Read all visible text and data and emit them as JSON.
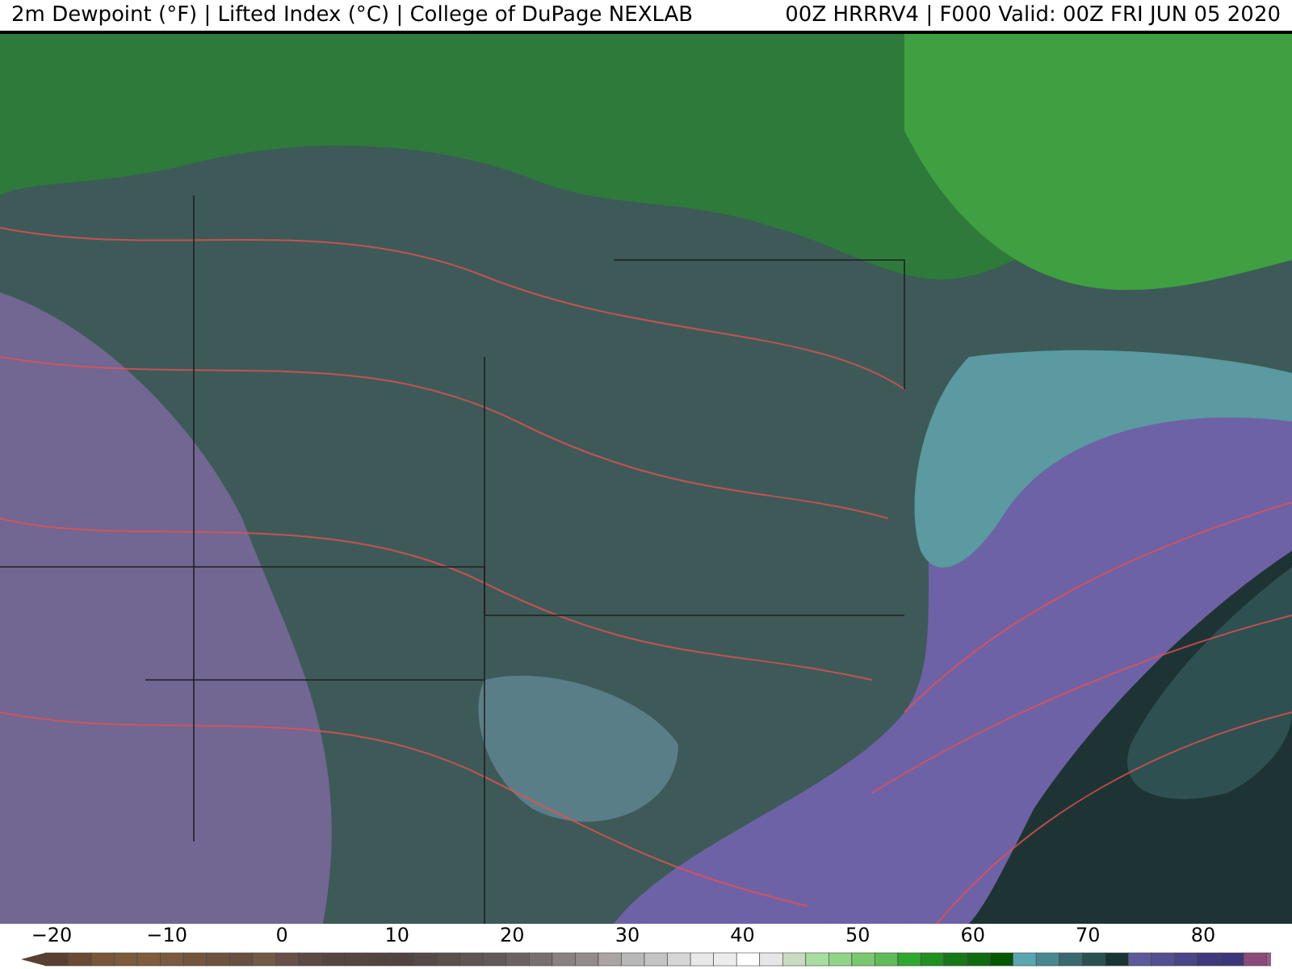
{
  "header": {
    "left_title": "2m Dewpoint (°F) | Lifted Index (°C) | College of DuPage NEXLAB",
    "right_title": "00Z HRRRV4 | F000 Valid: 00Z FRI JUN 05 2020"
  },
  "colorbar": {
    "ticks": [
      "−20",
      "−10",
      "0",
      "10",
      "20",
      "30",
      "40",
      "50",
      "60",
      "70",
      "80"
    ]
  }
}
